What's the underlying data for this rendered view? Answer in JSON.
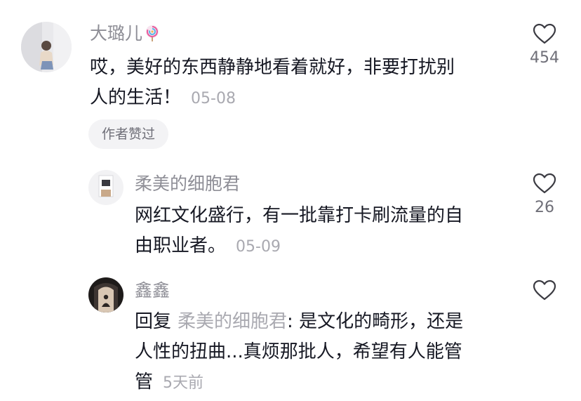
{
  "colors": {
    "username": "#8e8e96",
    "body_text": "#161823",
    "meta_text": "#a9a9b0",
    "badge_bg": "#f3f3f5"
  },
  "comments": [
    {
      "username": "大璐儿",
      "username_emoji": "lollipop-icon",
      "text_lines": [
        "哎，美好的东西静静地看着就好，非要打扰别",
        "人的生活！"
      ],
      "time": "05-08",
      "like_count": "454",
      "badge": "作者赞过"
    },
    {
      "username": "柔美的细胞君",
      "text_lines": [
        "网红文化盛行，有一批靠打卡刷流量的自",
        "由职业者。"
      ],
      "time": "05-09",
      "like_count": "26"
    },
    {
      "username": "鑫鑫",
      "reply_prefix": "回复",
      "reply_target": "柔美的细胞君",
      "reply_separator": ": ",
      "text_lines": [
        "是文化的畸形，还是",
        "人性的扭曲...真烦那批人，希望有人能管",
        "管"
      ],
      "time": "5天前"
    }
  ]
}
